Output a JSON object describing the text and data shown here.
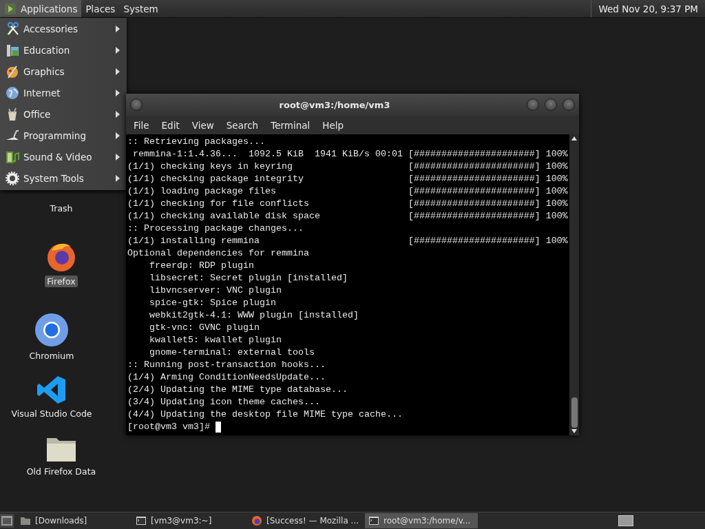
{
  "top_panel": {
    "menus": [
      {
        "label": "Applications",
        "selected": true
      },
      {
        "label": "Places",
        "selected": false
      },
      {
        "label": "System",
        "selected": false
      }
    ],
    "clock": "Wed Nov 20,  9:37 PM"
  },
  "app_menu": {
    "items": [
      {
        "label": "Accessories"
      },
      {
        "label": "Education"
      },
      {
        "label": "Graphics"
      },
      {
        "label": "Internet"
      },
      {
        "label": "Office"
      },
      {
        "label": "Programming"
      },
      {
        "label": "Sound & Video"
      },
      {
        "label": "System Tools"
      }
    ]
  },
  "desktop_icons": [
    {
      "label": "Trash",
      "kind": "trash",
      "selected": false
    },
    {
      "label": "Firefox",
      "kind": "firefox",
      "selected": true
    },
    {
      "label": "Chromium",
      "kind": "chromium",
      "selected": false
    },
    {
      "label": "Visual Studio Code",
      "kind": "vscode",
      "selected": false
    },
    {
      "label": "Old Firefox Data",
      "kind": "folder",
      "selected": false
    }
  ],
  "terminal": {
    "title": "root@vm3:/home/vm3",
    "menu": [
      "File",
      "Edit",
      "View",
      "Search",
      "Terminal",
      "Help"
    ],
    "lines": [
      ":: Retrieving packages...",
      " remmina-1:1.4.36...  1092.5 KiB  1941 KiB/s 00:01 [######################] 100%",
      "(1/1) checking keys in keyring                     [######################] 100%",
      "(1/1) checking package integrity                   [######################] 100%",
      "(1/1) loading package files                        [######################] 100%",
      "(1/1) checking for file conflicts                  [######################] 100%",
      "(1/1) checking available disk space                [######################] 100%",
      ":: Processing package changes...",
      "(1/1) installing remmina                           [######################] 100%",
      "Optional dependencies for remmina",
      "    freerdp: RDP plugin",
      "    libsecret: Secret plugin [installed]",
      "    libvncserver: VNC plugin",
      "    spice-gtk: Spice plugin",
      "    webkit2gtk-4.1: WWW plugin [installed]",
      "    gtk-vnc: GVNC plugin",
      "    kwallet5: kwallet plugin",
      "    gnome-terminal: external tools",
      ":: Running post-transaction hooks...",
      "(1/4) Arming ConditionNeedsUpdate...",
      "(2/4) Updating the MIME type database...",
      "(3/4) Updating icon theme caches...",
      "(4/4) Updating the desktop file MIME type cache..."
    ],
    "prompt": "[root@vm3 vm3]# "
  },
  "taskbar": {
    "items": [
      {
        "label": "[Downloads]",
        "kind": "folder",
        "selected": false
      },
      {
        "label": "[vm3@vm3:~]",
        "kind": "terminal",
        "selected": false
      },
      {
        "label": "[Success! — Mozilla ...",
        "kind": "firefox",
        "selected": false
      },
      {
        "label": "root@vm3:/home/v...",
        "kind": "terminal",
        "selected": true
      }
    ]
  }
}
